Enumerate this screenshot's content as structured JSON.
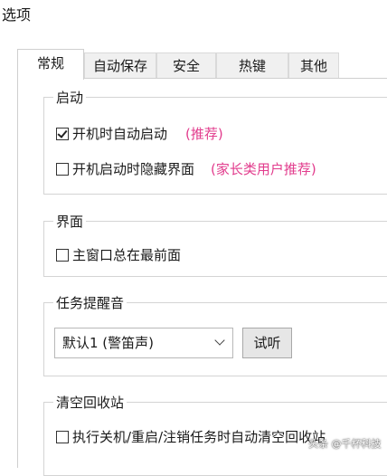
{
  "window": {
    "title": "选项"
  },
  "tabs": [
    {
      "label": "常规",
      "active": true
    },
    {
      "label": "自动保存"
    },
    {
      "label": "安全"
    },
    {
      "label": "热键"
    },
    {
      "label": "其他"
    }
  ],
  "groups": {
    "startup": {
      "title": "启动",
      "auto_start": {
        "label": "开机时自动启动",
        "checked": true,
        "note": "(推荐)"
      },
      "hide_on_start": {
        "label": "开机启动时隐藏界面",
        "checked": false,
        "note": "(家长类用户推荐)"
      }
    },
    "interface": {
      "title": "界面",
      "always_on_top": {
        "label": "主窗口总在最前面",
        "checked": false
      }
    },
    "alert": {
      "title": "任务提醒音",
      "sound_select": {
        "value": "默认1 (警笛声)"
      },
      "test_button": "试听"
    },
    "recycle": {
      "title": "清空回收站",
      "empty_on_task": {
        "label": "执行关机/重启/注销任务时自动清空回收站",
        "checked": false
      }
    }
  },
  "watermark": "头条 @千杯科技",
  "colors": {
    "note": "#e23c8d"
  }
}
